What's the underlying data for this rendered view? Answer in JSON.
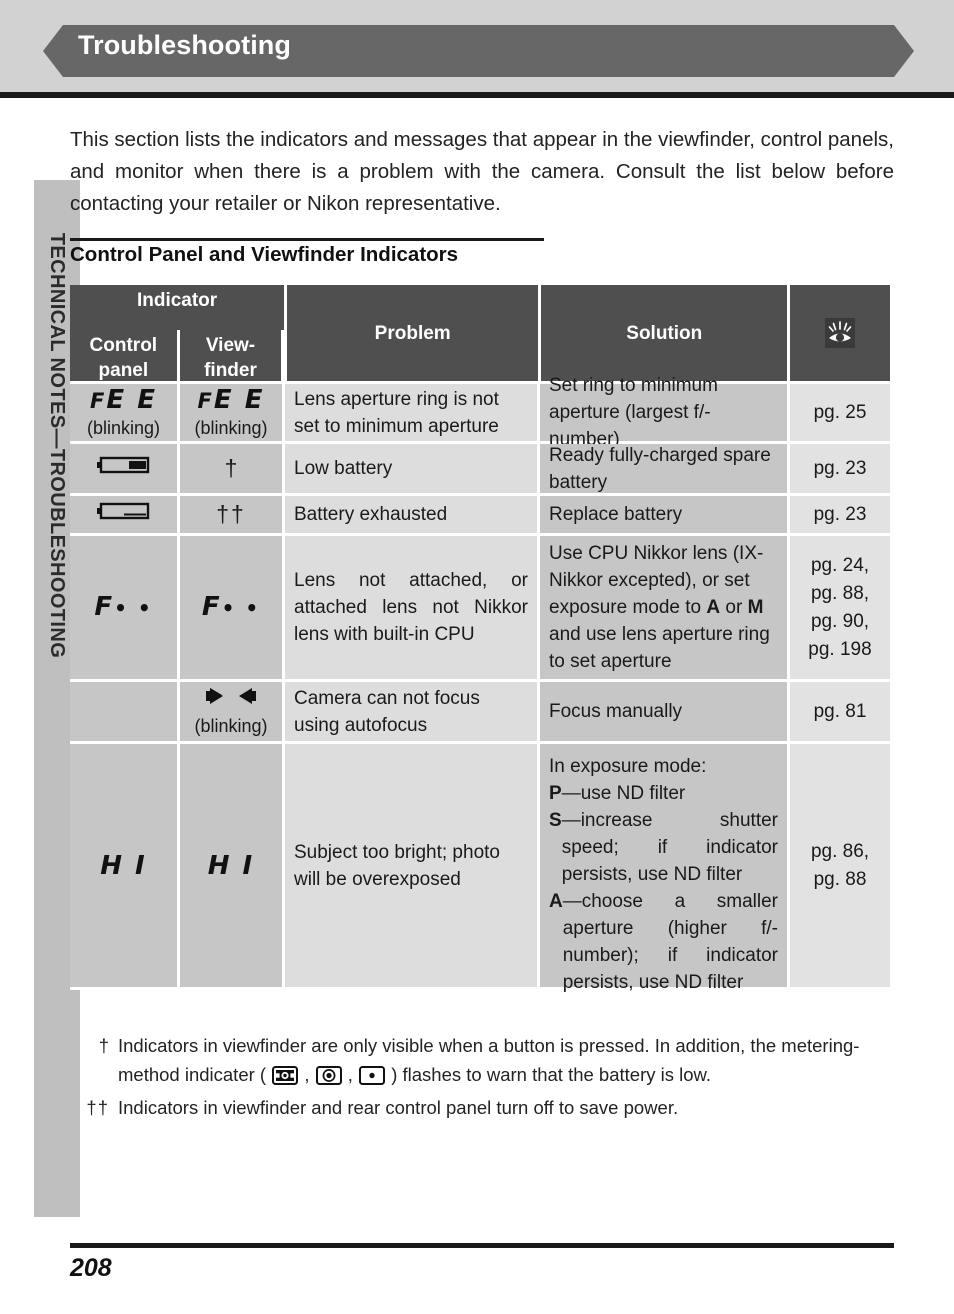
{
  "header": {
    "title": "Troubleshooting"
  },
  "sidebar": {
    "tab_label": "TECHNICAL NOTES—TROUBLESHOOTING"
  },
  "intro": "This section lists the indicators and messages that appear in the viewfinder, control panels, and monitor when there is a problem with the camera.  Consult the list below before contacting your retailer or Nikon representative.",
  "section": {
    "heading": "Control Panel and Viewfinder Indicators"
  },
  "table": {
    "header": {
      "indicator_group": "Indicator",
      "control_panel": "Control panel",
      "control_panel_l1": "Control",
      "control_panel_l2": "panel",
      "viewfinder_l1": "View-",
      "viewfinder_l2": "finder",
      "problem": "Problem",
      "solution": "Solution",
      "reference_icon": "eye-reference-icon"
    },
    "rows": [
      {
        "control_panel": "FEE",
        "control_panel_note": "(blinking)",
        "control_panel_icon": "lcd-fee",
        "viewfinder": "FEE",
        "viewfinder_note": "(blinking)",
        "viewfinder_icon": "lcd-fee",
        "problem": "Lens aperture ring is not set to minimum aperture",
        "solution": "Set ring to minimum aperture (largest f/-number)",
        "pages": "pg. 25"
      },
      {
        "control_panel": "",
        "control_panel_icon": "battery-low-icon",
        "viewfinder": "†",
        "viewfinder_icon": "dagger",
        "problem": "Low battery",
        "solution": "Ready fully-charged spare battery",
        "pages": "pg. 23"
      },
      {
        "control_panel": "",
        "control_panel_icon": "battery-empty-icon",
        "viewfinder": "††",
        "viewfinder_icon": "double-dagger",
        "problem": "Battery exhausted",
        "solution": "Replace battery",
        "pages": "pg. 23"
      },
      {
        "control_panel": "F- -",
        "control_panel_icon": "lcd-f-dashes",
        "viewfinder": "F- -",
        "viewfinder_icon": "lcd-f-dashes",
        "problem": "Lens not attached, or attached lens not Nikkor lens with built-in CPU",
        "solution_pre": "Use CPU Nikkor lens (IX-Nikkor excepted), or set exposure mode to ",
        "solution_a": "A",
        "solution_mid": " or ",
        "solution_m": "M",
        "solution_post": " and use lens aperture ring to set aperture",
        "pages": "pg. 24, pg. 88, pg. 90, pg. 198"
      },
      {
        "control_panel": "",
        "control_panel_icon": "",
        "viewfinder": "",
        "viewfinder_icon": "focus-arrows-icon",
        "viewfinder_note": "(blinking)",
        "problem": "Camera can not focus using autofocus",
        "solution": "Focus manually",
        "pages": "pg. 81"
      },
      {
        "control_panel": "HI",
        "control_panel_icon": "lcd-hi",
        "viewfinder": "HI",
        "viewfinder_icon": "lcd-hi",
        "problem": "Subject too bright; photo will be overexposed",
        "solution_intro": "In exposure mode:",
        "solution_items": [
          {
            "mode": "P",
            "text": "—use ND filter"
          },
          {
            "mode": "S",
            "text": "—increase shutter speed; if indicator persists, use ND filter"
          },
          {
            "mode": "A",
            "text": "—choose a smaller aperture (higher f/-number); if indicator persists, use ND filter"
          }
        ],
        "pages": "pg. 86, pg. 88"
      }
    ]
  },
  "footnotes": [
    {
      "mark": "†",
      "text_pre": "Indicators in viewfinder are only visible when a button is pressed.  In addition, the metering-method indicater ( ",
      "icons": [
        "matrix-metering-icon",
        "center-weighted-metering-icon",
        "spot-metering-icon"
      ],
      "text_post": " ) flashes to warn that the battery is low."
    },
    {
      "mark": "††",
      "text_pre": "Indicators in viewfinder and rear control panel turn off to save power.",
      "icons": [],
      "text_post": ""
    }
  ],
  "footer": {
    "page_number": "208"
  },
  "colors": {
    "header_band": "#d2d2d2",
    "header_chevron": "#676767",
    "table_header": "#4f4f4f",
    "shade_dark": "#c6c6c6",
    "shade_light": "#dddddd",
    "sidebar_tab": "#bfbfbf"
  }
}
